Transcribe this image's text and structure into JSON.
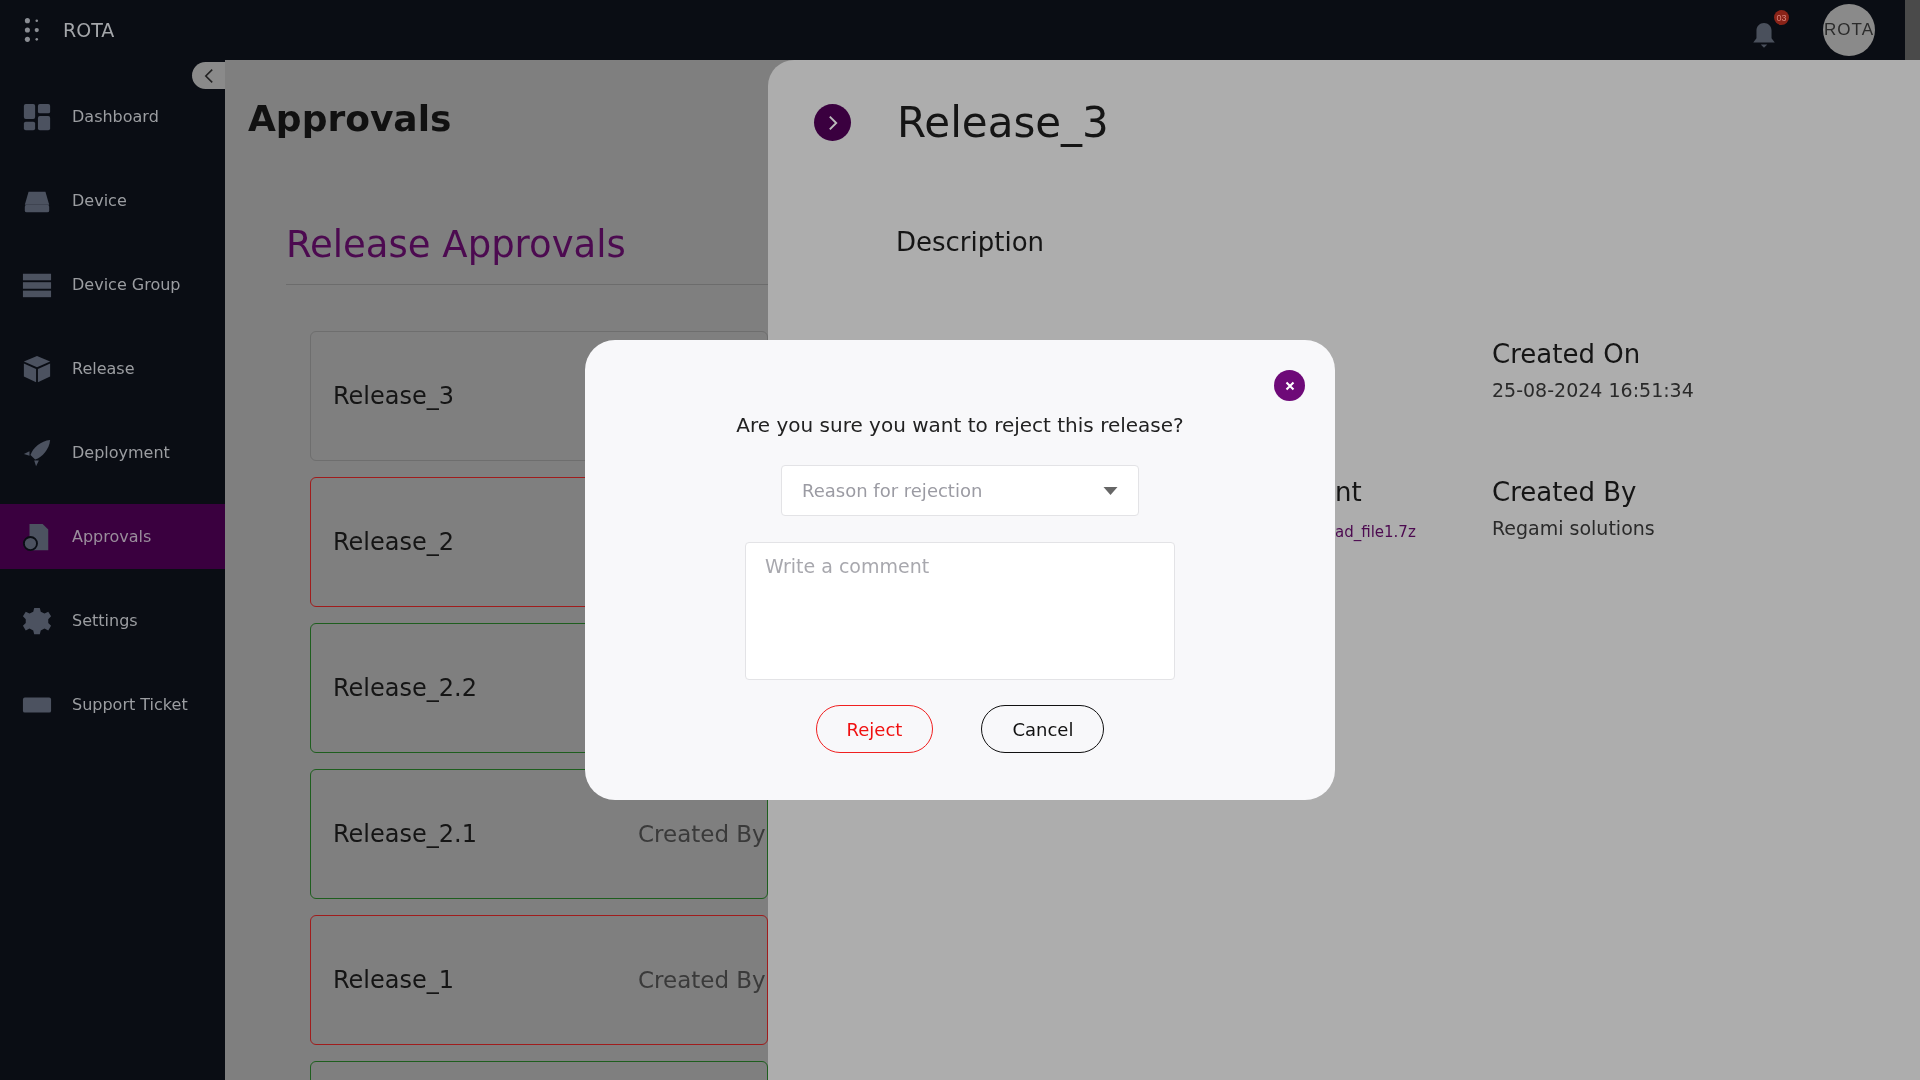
{
  "app": {
    "name": "ROTA"
  },
  "header": {
    "notification_count": "03",
    "avatar_text": "ROTA"
  },
  "sidebar": {
    "items": [
      {
        "label": "Dashboard",
        "selected": false
      },
      {
        "label": "Device",
        "selected": false
      },
      {
        "label": "Device Group",
        "selected": false
      },
      {
        "label": "Release",
        "selected": false
      },
      {
        "label": "Deployment",
        "selected": false
      },
      {
        "label": "Approvals",
        "selected": true
      },
      {
        "label": "Settings",
        "selected": false
      },
      {
        "label": "Support Ticket",
        "selected": false
      }
    ]
  },
  "page": {
    "title": "Approvals",
    "section_title": "Release Approvals",
    "releases": [
      {
        "name": "Release_3",
        "color": "#6e6e6e"
      },
      {
        "name": "Release_2",
        "color": "#a01c1c"
      },
      {
        "name": "Release_2.2",
        "color": "#1e5e1e"
      },
      {
        "name": "Release_2.1",
        "color": "#1e5e1e",
        "created_by_label": "Created By"
      },
      {
        "name": "Release_1",
        "color": "#a01c1c",
        "created_by_label": "Created By"
      },
      {
        "color": "#1e5e1e"
      }
    ]
  },
  "detail_panel": {
    "title": "Release_3",
    "description_label": "Description",
    "attachment": {
      "label": "nt",
      "value": "ad_file1.7z"
    },
    "created_on": {
      "label": "Created On",
      "value": "25-08-2024 16:51:34"
    },
    "created_by": {
      "label": "Created By",
      "value": "Regami solutions"
    }
  },
  "dialog": {
    "question": "Are you sure you want to reject this release?",
    "reason": {
      "placeholder": "Reason for rejection"
    },
    "comment": {
      "placeholder": "Write a comment"
    },
    "buttons": [
      {
        "label": "Reject",
        "kind": "danger"
      },
      {
        "label": "Cancel",
        "kind": "neutral"
      }
    ]
  }
}
